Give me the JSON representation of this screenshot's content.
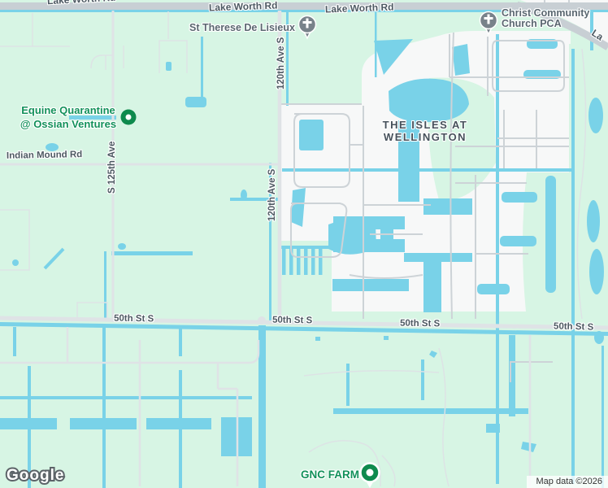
{
  "colors": {
    "land": "#d7f5e4",
    "water": "#79d2e8",
    "residential": "#f7f8f8",
    "road_major": "#c8cfd4",
    "road_minor": "#dfe3e6",
    "street": "#cdd3d7",
    "path": "#dde3e5",
    "road_label": "#4d5962",
    "poi_church_label": "#5a6770",
    "poi_green_label": "#12915a",
    "area_label": "#46515b",
    "marker_gray": "#78828a",
    "marker_green": "#0e8a4d",
    "attribution_text": "#333333"
  },
  "roads": {
    "lake_worth_rd": "Lake Worth Rd",
    "lake_worth_rd_partial": "La",
    "indian_mound_rd": "Indian Mound Rd",
    "s_125th_ave": "S 125th Ave",
    "ave_120th_s": "120th Ave S",
    "st_50th_s": "50th St S"
  },
  "pois": {
    "st_therese": "St Therese De Lisieux",
    "christ_community": {
      "line1": "Christ Community",
      "line2": "Church PCA"
    },
    "equine": {
      "line1": "Equine Quarantine",
      "line2": "@ Ossian Ventures"
    },
    "gnc_farm": "GNC FARM"
  },
  "areas": {
    "isles": {
      "line1": "THE ISLES AT",
      "line2": "WELLINGTON"
    }
  },
  "attribution": {
    "logo": "Google",
    "text": "Map data ©2026"
  }
}
